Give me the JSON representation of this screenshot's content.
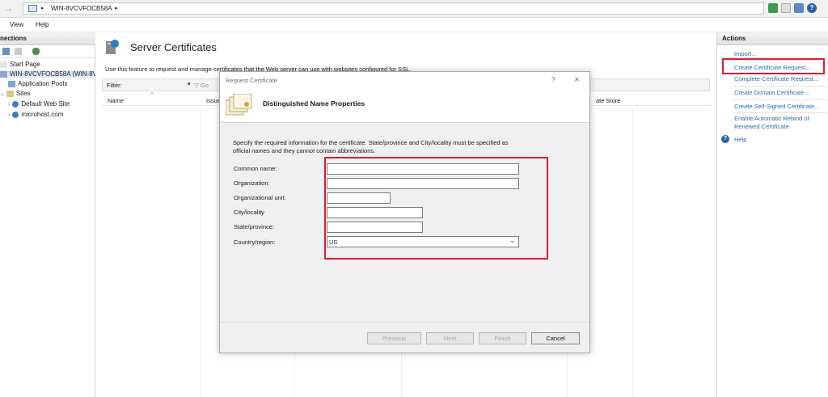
{
  "address_bar": {
    "back_glyph": "→",
    "server": "WIN-8VCVFOCB58A",
    "separator": "▸",
    "help_glyph": "?"
  },
  "menu": {
    "items": [
      "View",
      "Help"
    ],
    "connections_title": "nections"
  },
  "connections": {
    "tree": [
      {
        "label": "Start Page",
        "indent": 0
      },
      {
        "label": "WIN-8VCVFOCB58A (WIN-8V",
        "indent": 0
      },
      {
        "label": "Application Pools",
        "indent": 1
      },
      {
        "label": "Sites",
        "indent": 0
      },
      {
        "label": "Default Web Site",
        "indent": 2
      },
      {
        "label": "microhost.com",
        "indent": 2
      }
    ]
  },
  "main": {
    "title": "Server Certificates",
    "description": "Use this feature to request and manage certificates that the Web server can use with websites configured for SSL.",
    "filter_label": "Filter:",
    "go_label": "Go",
    "columns": [
      "Name",
      "Issue",
      "ate Store"
    ]
  },
  "actions": {
    "header": "Actions",
    "items": [
      "Import...",
      "Create Certificate Request...",
      "Complete Certificate Request...",
      "Create Domain Certificate...",
      "Create Self-Signed Certificate...",
      "Enable Automatic Rebind of",
      "Renewed Certificate"
    ],
    "help": "Help"
  },
  "dialog": {
    "title": "Request Certificate",
    "help_glyph": "?",
    "close_glyph": "✕",
    "heading": "Distinguished Name Properties",
    "instructions_line1": "Specify the required information for the certificate. State/province and City/locality must be specified as",
    "instructions_line2": "official names and they cannot contain abbreviations.",
    "fields": {
      "common_name": {
        "label": "Common name:",
        "value": ""
      },
      "organization": {
        "label": "Organization:",
        "value": ""
      },
      "organizational_unit": {
        "label": "Organizational unit:",
        "value": ""
      },
      "city": {
        "label": "City/locality",
        "value": ""
      },
      "state": {
        "label": "State/province:",
        "value": ""
      },
      "country": {
        "label": "Country/region:",
        "value": "US"
      }
    },
    "buttons": {
      "previous": "Previous",
      "next": "Next",
      "finish": "Finish",
      "cancel": "Cancel"
    }
  },
  "colors": {
    "highlight": "#e01e2a",
    "link": "#2a6cb3"
  }
}
